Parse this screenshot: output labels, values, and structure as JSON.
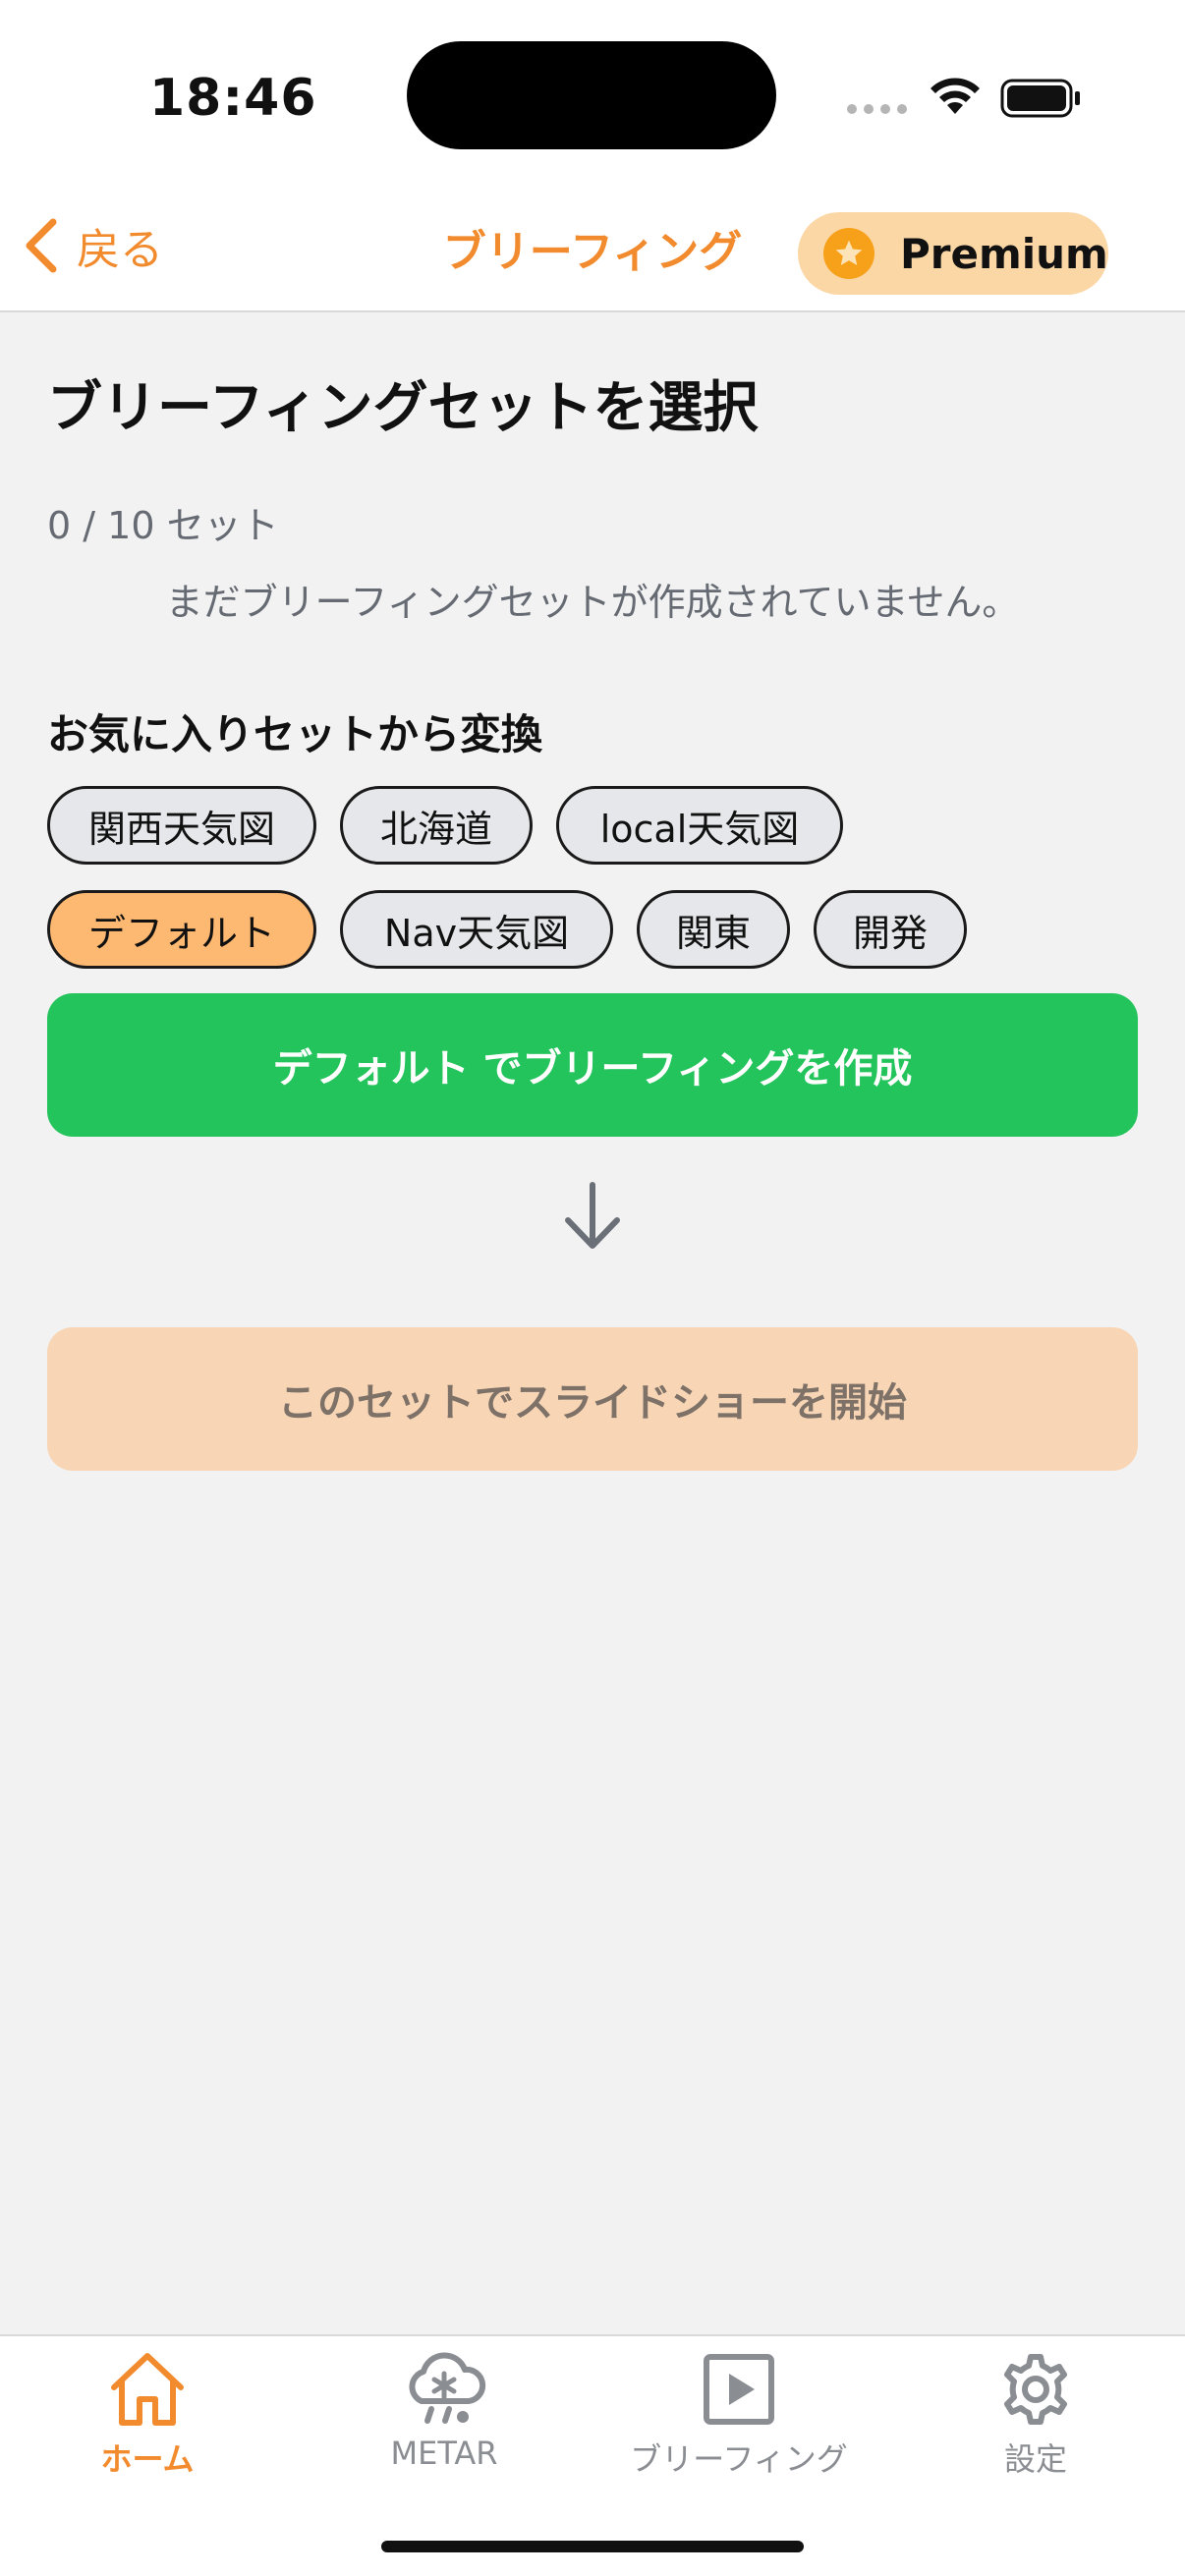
{
  "status_bar": {
    "time": "18:46"
  },
  "nav": {
    "back_label": "戻る",
    "title": "ブリーフィング",
    "premium_label": "Premium",
    "accent_color": "#f28a2e"
  },
  "content": {
    "page_title": "ブリーフィングセットを選択",
    "set_count": "0 / 10 セット",
    "empty_message": "まだブリーフィングセットが作成されていません。",
    "favorites_title": "お気に入りセットから変換",
    "chips": [
      {
        "label": "関西天気図",
        "selected": false
      },
      {
        "label": "北海道",
        "selected": false
      },
      {
        "label": "local天気図",
        "selected": false
      },
      {
        "label": "デフォルト",
        "selected": true
      },
      {
        "label": "Nav天気図",
        "selected": false
      },
      {
        "label": "関東",
        "selected": false
      },
      {
        "label": "開発",
        "selected": false
      }
    ],
    "create_button": "デフォルト でブリーフィングを作成",
    "start_button": "このセットでスライドショーを開始"
  },
  "tab_bar": {
    "tabs": [
      {
        "label": "ホーム",
        "icon": "home-icon",
        "active": true
      },
      {
        "label": "METAR",
        "icon": "weather-icon",
        "active": false
      },
      {
        "label": "ブリーフィング",
        "icon": "play-icon",
        "active": false
      },
      {
        "label": "設定",
        "icon": "gear-icon",
        "active": false
      }
    ]
  },
  "colors": {
    "accent": "#f28a2e",
    "create_green": "#24c45c",
    "selected_chip": "#fdb872",
    "start_disabled": "#f8d5b4"
  }
}
